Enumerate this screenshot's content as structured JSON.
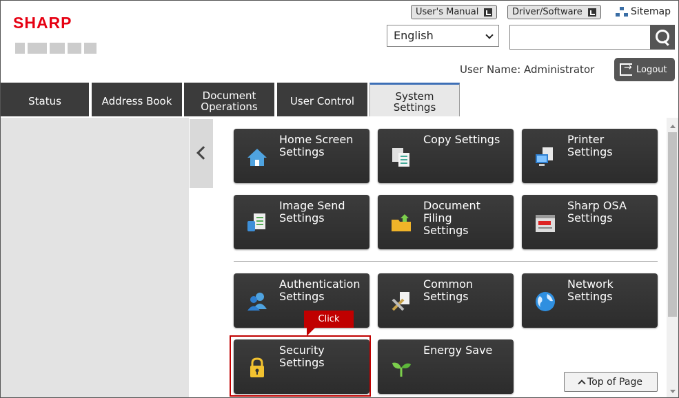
{
  "header": {
    "brand": "SHARP",
    "users_manual": "User's Manual",
    "driver_software": "Driver/Software",
    "sitemap": "Sitemap",
    "language": "English",
    "search_value": "",
    "username": "User Name: Administrator",
    "logout": "Logout"
  },
  "tabs": [
    {
      "label": "Status",
      "active": false
    },
    {
      "label": "Address Book",
      "active": false
    },
    {
      "label": "Document\nOperations",
      "active": false
    },
    {
      "label": "User Control",
      "active": false
    },
    {
      "label": "System\nSettings",
      "active": true
    }
  ],
  "tiles": [
    {
      "label": "Home Screen\nSettings",
      "icon": "home-icon"
    },
    {
      "label": "Copy Settings",
      "icon": "copy-icon"
    },
    {
      "label": "Printer\nSettings",
      "icon": "printer-icon"
    },
    {
      "label": "Image Send\nSettings",
      "icon": "image-send-icon"
    },
    {
      "label": "Document\nFiling\nSettings",
      "icon": "document-filing-icon"
    },
    {
      "label": "Sharp OSA\nSettings",
      "icon": "osa-icon"
    },
    {
      "label": "Authentication\nSettings",
      "icon": "users-icon"
    },
    {
      "label": "Common\nSettings",
      "icon": "tools-icon"
    },
    {
      "label": "Network\nSettings",
      "icon": "globe-icon"
    },
    {
      "label": "Security\nSettings",
      "icon": "lock-icon"
    },
    {
      "label": "Energy Save",
      "icon": "sprout-icon"
    }
  ],
  "callout": "Click",
  "top_of_page": "Top of Page",
  "colors": {
    "brand_red": "#e60012",
    "tab_dark": "#3b3b3b",
    "tile_dark": "#333333",
    "highlight_red": "#c00000",
    "active_tab_accent": "#3d6fb6"
  }
}
